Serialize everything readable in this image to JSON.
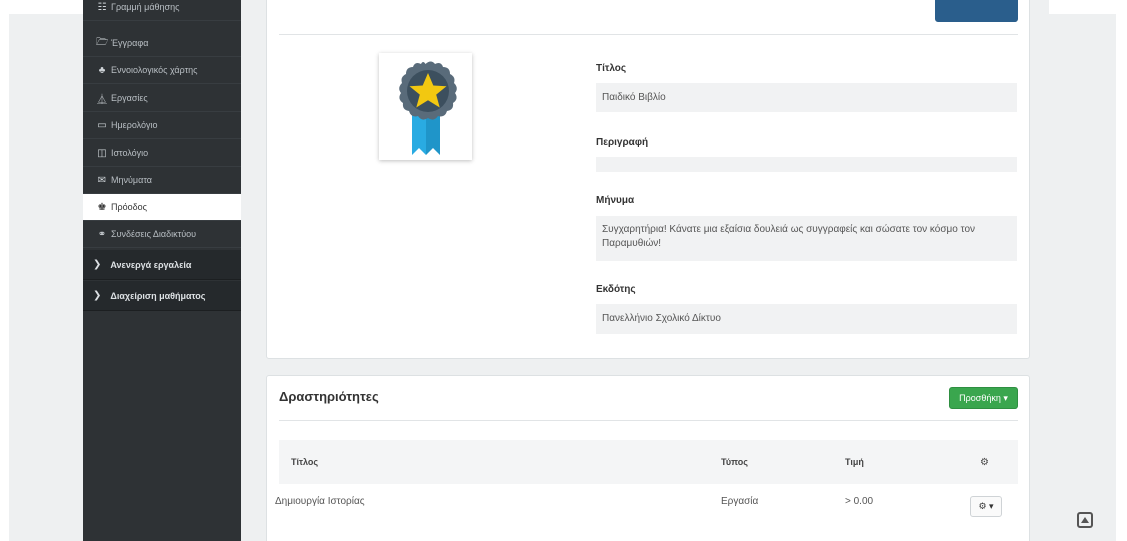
{
  "sidebar": {
    "items": [
      {
        "label": "Γραμμή μάθησης",
        "icon": "learning-path-icon",
        "glyph": "☷"
      },
      {
        "label": "Έγγραφα",
        "icon": "folder-icon",
        "glyph": "🗁"
      },
      {
        "label": "Εννοιολογικός χάρτης",
        "icon": "sitemap-icon",
        "glyph": "♣"
      },
      {
        "label": "Εργασίες",
        "icon": "flask-icon",
        "glyph": "⏅"
      },
      {
        "label": "Ημερολόγιο",
        "icon": "calendar-icon",
        "glyph": "▭"
      },
      {
        "label": "Ιστολόγιο",
        "icon": "columns-icon",
        "glyph": "◫"
      },
      {
        "label": "Μηνύματα",
        "icon": "envelope-icon",
        "glyph": "✉"
      },
      {
        "label": "Πρόοδος",
        "icon": "trophy-icon",
        "glyph": "♚"
      },
      {
        "label": "Συνδέσεις Διαδικτύου",
        "icon": "link-icon",
        "glyph": "⚭"
      }
    ],
    "groups": [
      {
        "label": "Ανενεργά εργαλεία"
      },
      {
        "label": "Διαχείριση μαθήματος"
      }
    ],
    "active_index": 7
  },
  "badge": {
    "icon": "badge-star-icon",
    "colors": {
      "outer": "#596b7a",
      "inner": "#3c4f5e",
      "star": "#f2c811",
      "ribbon": "#29abe2"
    }
  },
  "details": {
    "title_label": "Τίτλος",
    "title_value": "Παιδικό Βιβλίο",
    "description_label": "Περιγραφή",
    "description_value": "",
    "message_label": "Μήνυμα",
    "message_value": "Συγχαρητήρια! Κάνατε μια εξαίσια δουλειά ως συγγραφείς και σώσατε τον κόσμο τον Παραμυθιών!",
    "issuer_label": "Εκδότης",
    "issuer_value": "Πανελλήνιο Σχολικό Δίκτυο"
  },
  "activities": {
    "heading": "Δραστηριότητες",
    "add_button": "Προσθήκη ▾",
    "columns": {
      "title": "Τίτλος",
      "type": "Τύπος",
      "value": "Τιμή",
      "settings_icon": "cogs-icon"
    },
    "rows": [
      {
        "title": "Δημιουργία Ιστορίας",
        "type": "Εργασία",
        "value": "> 0.00",
        "action": "⚙ ▾"
      }
    ]
  },
  "colors": {
    "sidebar": "#2e3235",
    "primary": "#2a5e8c",
    "success": "#3aa64e",
    "background": "#eef0f1"
  }
}
